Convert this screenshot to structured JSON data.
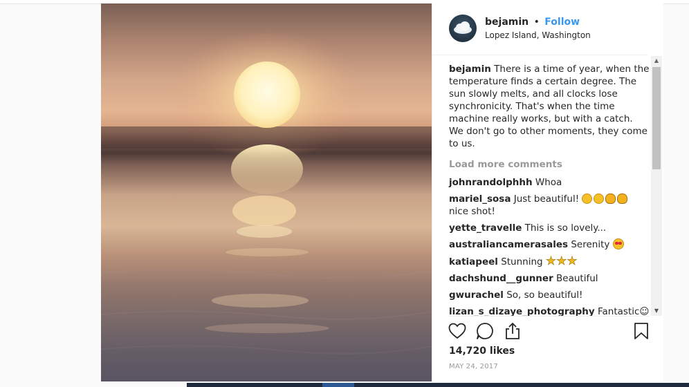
{
  "post": {
    "username": "bejamin",
    "separator": "•",
    "follow_label": "Follow",
    "location": "Lopez Island, Washington",
    "caption": {
      "username": "bejamin",
      "text": "There is a time of year, when the temperature finds a certain degree. The sun slowly melts, and all clocks lose synchronicity. That's when the time machine really works, but with a catch. We don't go to other moments, they come to us."
    },
    "load_more_label": "Load more comments",
    "comments": [
      {
        "username": "johnrandolphhh",
        "text": "Whoa"
      },
      {
        "username": "mariel_sosa",
        "text": "Just beautiful!",
        "text2": "nice shot!"
      },
      {
        "username": "yette_travelle",
        "text": "This is so lovely..."
      },
      {
        "username": "australiancamerasales",
        "text": "Serenity"
      },
      {
        "username": "katiapeel",
        "text": "Stunning"
      },
      {
        "username": "dachshund__gunner",
        "text": "Beautiful"
      },
      {
        "username": "gwurachel",
        "text": "So, so beautiful!"
      },
      {
        "username": "lizan_s_dizaye_photography",
        "text": "Fantastic☺"
      }
    ],
    "likes": "14,720 likes",
    "date": "MAY 24, 2017"
  },
  "icons": {
    "like": "heart-icon",
    "comment": "comment-icon",
    "share": "share-icon",
    "save": "bookmark-icon"
  },
  "colors": {
    "link": "#3897f0",
    "muted": "#999999",
    "text": "#262626"
  }
}
